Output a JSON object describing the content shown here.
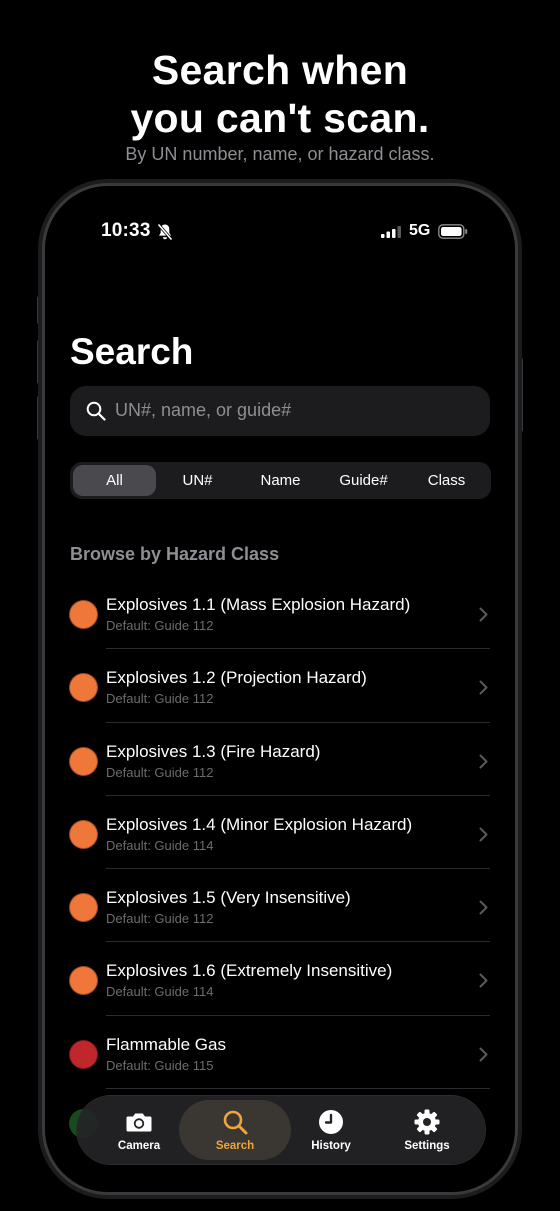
{
  "promo": {
    "headline_line1": "Search when",
    "headline_line2": "you can't scan.",
    "subtitle": "By UN number, name, or hazard class."
  },
  "status_bar": {
    "time": "10:33",
    "network": "5G"
  },
  "page": {
    "title": "Search"
  },
  "search": {
    "placeholder": "UN#, name, or guide#"
  },
  "filters": {
    "selected": "All",
    "options": [
      "All",
      "UN#",
      "Name",
      "Guide#",
      "Class"
    ]
  },
  "section": {
    "header": "Browse by Hazard Class"
  },
  "hazard_classes": [
    {
      "title": "Explosives 1.1 (Mass Explosion Hazard)",
      "subtitle": "Default: Guide 112",
      "color": "#f0773a"
    },
    {
      "title": "Explosives 1.2 (Projection Hazard)",
      "subtitle": "Default: Guide 112",
      "color": "#f0773a"
    },
    {
      "title": "Explosives 1.3 (Fire Hazard)",
      "subtitle": "Default: Guide 112",
      "color": "#f0773a"
    },
    {
      "title": "Explosives 1.4 (Minor Explosion Hazard)",
      "subtitle": "Default: Guide 114",
      "color": "#f0773a"
    },
    {
      "title": "Explosives 1.5 (Very Insensitive)",
      "subtitle": "Default: Guide 112",
      "color": "#f0773a"
    },
    {
      "title": "Explosives 1.6 (Extremely Insensitive)",
      "subtitle": "Default: Guide 114",
      "color": "#f0773a"
    },
    {
      "title": "Flammable Gas",
      "subtitle": "Default: Guide 115",
      "color": "#c0272d"
    }
  ],
  "tabs": [
    {
      "label": "Camera",
      "icon": "camera-icon"
    },
    {
      "label": "Search",
      "icon": "search-icon"
    },
    {
      "label": "History",
      "icon": "clock-icon"
    },
    {
      "label": "Settings",
      "icon": "gear-icon"
    }
  ],
  "active_tab": "Search",
  "colors": {
    "accent": "#f0a43a",
    "explosive": "#f0773a",
    "flammable_gas": "#c0272d"
  }
}
